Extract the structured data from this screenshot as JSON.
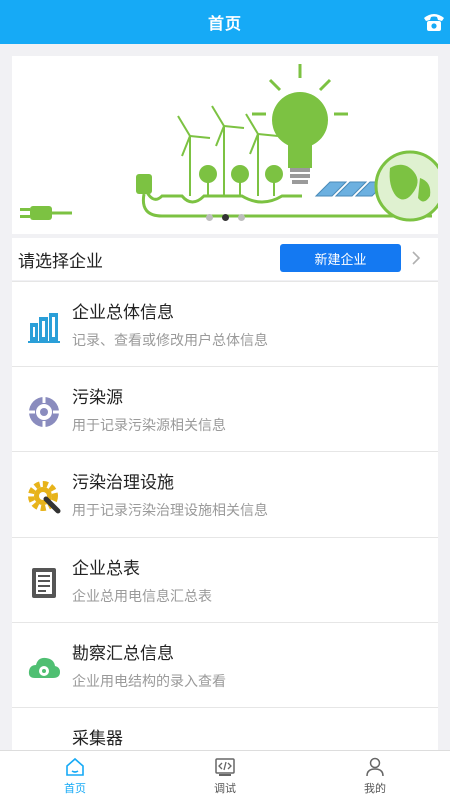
{
  "header": {
    "title": "首页"
  },
  "banner": {
    "slide_count": 3,
    "active_slide": 2
  },
  "company": {
    "prompt": "请选择企业",
    "new_button": "新建企业"
  },
  "menu": [
    {
      "title": "企业总体信息",
      "subtitle": "记录、查看或修改用户总体信息",
      "icon": "building-icon"
    },
    {
      "title": "污染源",
      "subtitle": "用于记录污染源相关信息",
      "icon": "pollution-source-icon"
    },
    {
      "title": "污染治理设施",
      "subtitle": "用于记录污染治理设施相关信息",
      "icon": "gear-wrench-icon"
    },
    {
      "title": "企业总表",
      "subtitle": "企业总用电信息汇总表",
      "icon": "meter-icon"
    },
    {
      "title": "勘察汇总信息",
      "subtitle": "企业用电结构的录入查看",
      "icon": "cloud-gear-icon"
    },
    {
      "title": "采集器",
      "subtitle": "",
      "icon": "collector-icon"
    }
  ],
  "tabs": [
    {
      "label": "首页",
      "icon": "home-icon",
      "active": true
    },
    {
      "label": "调试",
      "icon": "code-icon",
      "active": false
    },
    {
      "label": "我的",
      "icon": "user-icon",
      "active": false
    }
  ],
  "colors": {
    "primary": "#16aaf6",
    "button": "#1479f2",
    "green": "#7cc242"
  }
}
